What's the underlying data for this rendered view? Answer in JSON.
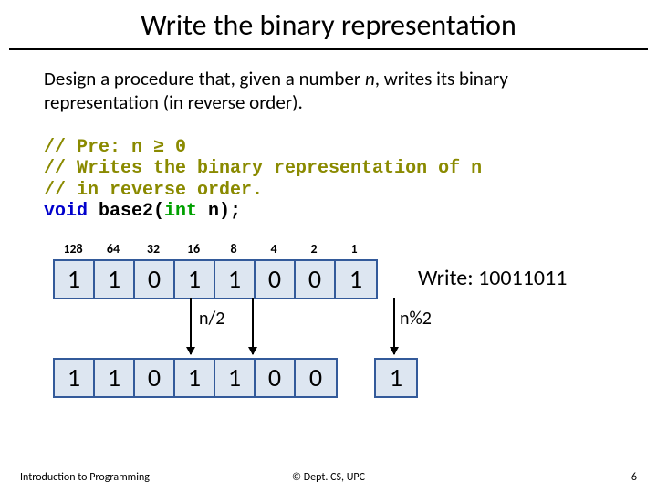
{
  "title": "Write the binary representation",
  "problem_html": "Design a procedure that, given a number <em>n</em>, writes its binary representation (in reverse order).",
  "code": {
    "c1": "// Pre: n ≥ 0",
    "c2": "// Writes the binary representation of n",
    "c3": "// in reverse order.",
    "kw_void": "void",
    "fn": " base2(",
    "kw_int": "int",
    "rest": " n);"
  },
  "powers": [
    "128",
    "64",
    "32",
    "16",
    "8",
    "4",
    "2",
    "1"
  ],
  "top_bits": [
    "1",
    "1",
    "0",
    "1",
    "1",
    "0",
    "0",
    "1"
  ],
  "bottom_left_bits": [
    "1",
    "1",
    "0",
    "1",
    "1",
    "0",
    "0"
  ],
  "bottom_right_bits": [
    "1"
  ],
  "write_label": "Write: 10011011",
  "ndiv2": "n/2",
  "nmod2": "n%2",
  "footer": {
    "left": "Introduction to Programming",
    "center": "© Dept. CS, UPC",
    "right": "6"
  }
}
